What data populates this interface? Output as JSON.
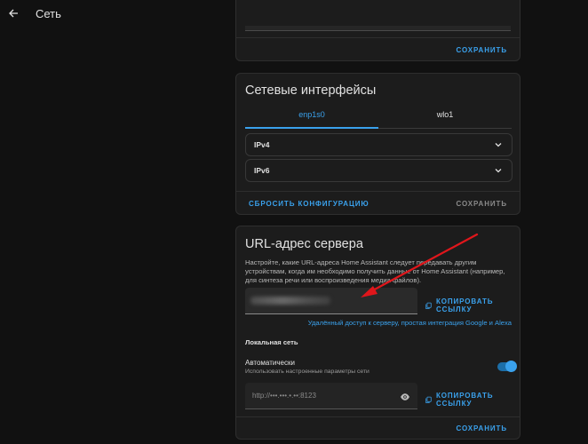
{
  "header": {
    "title": "Сеть"
  },
  "top_card": {
    "save_label": "СОХРАНИТЬ"
  },
  "interfaces": {
    "title": "Сетевые интерфейсы",
    "tabs": [
      {
        "label": "enp1s0",
        "active": true
      },
      {
        "label": "wlo1",
        "active": false
      }
    ],
    "ipv4_label": "IPv4",
    "ipv6_label": "IPv6",
    "reset_label": "СБРОСИТЬ КОНФИГУРАЦИЮ",
    "save_label": "СОХРАНИТЬ"
  },
  "server_url": {
    "title": "URL-адрес сервера",
    "description": "Настройте, какие URL-адреса Home Assistant следует передавать другим устройствам, когда им необходимо получить данные от Home Assistant (например, для синтеза речи или воспроизведения медиа файлов).",
    "copy_label": "КОПИРОВАТЬ ССЫЛКУ",
    "remote_link": "Удалённый доступ к серверу, простая интеграция Google и Alexa",
    "local_title": "Локальная сеть",
    "auto_label": "Автоматически",
    "auto_sub": "Использовать настроенные параметры сети",
    "auto_enabled": true,
    "local_url": "http://•••.•••.•.••:8123",
    "copy_label_2": "КОПИРОВАТЬ ССЫЛКУ",
    "save_label": "СОХРАНИТЬ"
  },
  "colors": {
    "accent": "#3aa1ec",
    "annotation_arrow": "#e0161b",
    "card": "#1c1c1c",
    "background": "#111111"
  }
}
